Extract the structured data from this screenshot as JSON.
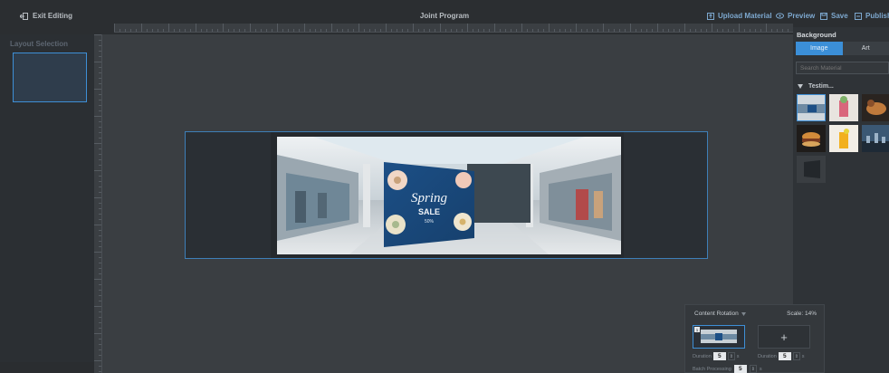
{
  "topbar": {
    "exit_label": "Exit Editing",
    "title": "Joint Program",
    "upload_label": "Upload Material",
    "preview_label": "Preview",
    "save_label": "Save",
    "publish_label": "Publish"
  },
  "left_panel": {
    "title": "Layout Selection"
  },
  "canvas": {
    "promo": {
      "line1": "Spring",
      "line2": "SALE",
      "line3": "50%"
    }
  },
  "right_panel": {
    "title": "Background",
    "tabs": [
      "Image",
      "Art"
    ],
    "search_placeholder": "Search Material",
    "folder_label": "Testim..."
  },
  "rotation_panel": {
    "title": "Content Rotation",
    "scale_text": "Scale: 14%",
    "slot1_badge": "1",
    "add_symbol": "+",
    "duration_label": "Duration",
    "duration1_value": "5",
    "duration2_value": "5",
    "batch_label": "Batch Processing",
    "batch_value": "5",
    "unit": "s"
  },
  "colors": {
    "accent": "#3b8fd8",
    "topbar": "#2b2e31",
    "canvas": "#3a3e42"
  }
}
